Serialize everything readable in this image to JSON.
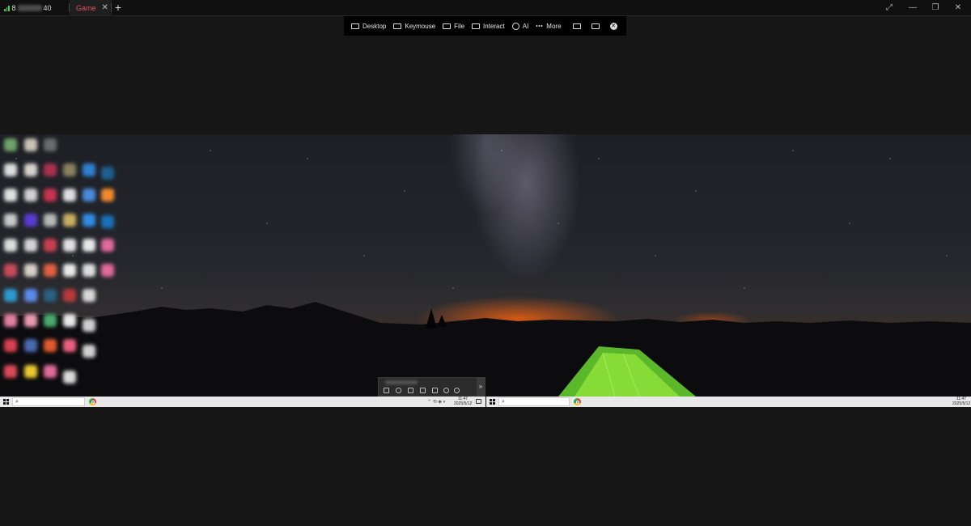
{
  "tabs": [
    {
      "label_prefix": "8",
      "label_suffix": "40",
      "signal_icon": "signal-bars-icon"
    },
    {
      "label": "Game",
      "close_glyph": "✕",
      "active": true
    }
  ],
  "new_tab_glyph": "+",
  "window_controls": {
    "fit": "⤢",
    "minimize": "—",
    "restore": "❐",
    "close": "✕"
  },
  "toolbar": {
    "items": [
      {
        "label": "Desktop",
        "icon": "monitor-icon"
      },
      {
        "label": "Keymouse",
        "icon": "keyboard-icon"
      },
      {
        "label": "File",
        "icon": "file-transfer-icon"
      },
      {
        "label": "Interact",
        "icon": "interact-icon"
      },
      {
        "label": "AI",
        "icon": "eye-icon"
      },
      {
        "label": "More",
        "icon": "more-dots-icon"
      }
    ],
    "extra_icons": [
      "screen-icon",
      "window-icon",
      "close-circle-icon"
    ],
    "close_glyph": "✕"
  },
  "remote": {
    "clock_left": {
      "time": "11:47",
      "date": "2025/5/12"
    },
    "clock_right": {
      "time": "11:47",
      "date": "2025/5/12"
    },
    "tray_glyphs": "⌃ ⟲ ◈ ◐",
    "minibar_expand": "»"
  }
}
